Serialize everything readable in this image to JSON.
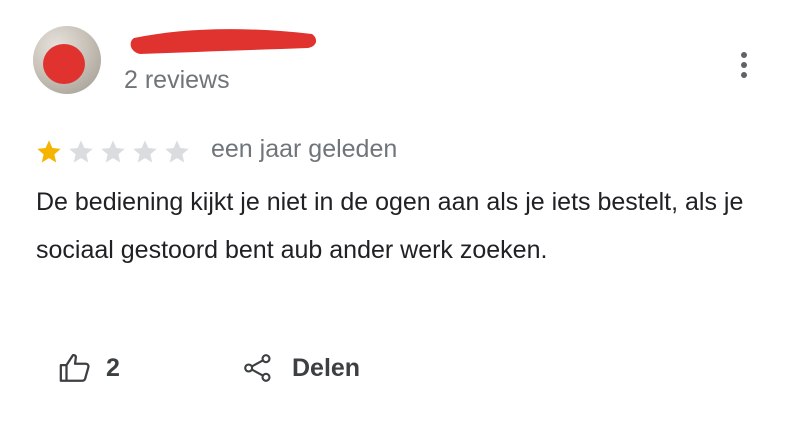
{
  "review": {
    "author": {
      "name_visible_fragment": "",
      "review_count": "2 reviews"
    },
    "rating": 1,
    "rating_max": 5,
    "date": "een jaar geleden",
    "text": "De bediening kijkt je niet in de ogen aan als je iets bestelt, als je sociaal gestoord bent aub ander werk zoeken.",
    "actions": {
      "like_count": "2",
      "share_label": "Delen"
    }
  },
  "colors": {
    "star_filled": "#f4b400",
    "star_empty": "#dadce0",
    "redaction": "#e0332f",
    "secondary_text": "#70757a"
  },
  "icons": {
    "more": "more-vert-icon",
    "like": "thumbs-up-icon",
    "share": "share-icon",
    "star": "star-icon"
  }
}
